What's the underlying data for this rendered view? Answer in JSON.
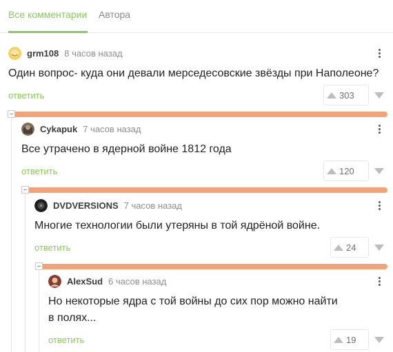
{
  "tabs": {
    "all_comments": "Все комментарии",
    "authors": "Автора"
  },
  "comments": [
    {
      "author": "grm108",
      "time": "8 часов назад",
      "text": "Один вопрос- куда они девали мерседесовские звёзды при Наполеоне?",
      "reply_label": "ответить",
      "score": "303"
    },
    {
      "author": "Cykapuk",
      "time": "7 часов назад",
      "text": "Все утрачено в ядерной войне 1812 года",
      "reply_label": "ответить",
      "score": "120"
    },
    {
      "author": "DVDVERSIONS",
      "time": "7 часов назад",
      "text": "Многие технологии были утеряны в той ядрёной войне.",
      "reply_label": "ответить",
      "score": "24"
    },
    {
      "author": "AlexSud",
      "time": "6 часов назад",
      "text_line1": "Но некоторые ядра с той войны до сих пор можно найти",
      "text_line2": "в полях...",
      "reply_label": "ответить",
      "score": "19"
    }
  ],
  "colors": {
    "accent": "#8ac858",
    "thread_bar": "#f2a478"
  }
}
